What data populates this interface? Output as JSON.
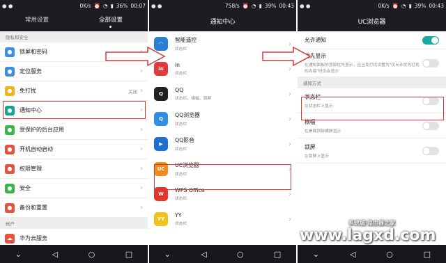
{
  "screen1": {
    "status": {
      "left": "",
      "net": "0K/s",
      "battery": "36%",
      "time": "00:07"
    },
    "tabs": [
      "常用设置",
      "全部设置"
    ],
    "active_tab": 1,
    "section1": "隐私和安全",
    "items": [
      {
        "label": "锁屏和密码",
        "icon": "lock-icon",
        "color": "#3d8fe0",
        "value": ""
      },
      {
        "label": "定位服务",
        "icon": "location-icon",
        "color": "#3d8fe0",
        "value": ""
      },
      {
        "label": "免打扰",
        "icon": "moon-icon",
        "color": "#f2b21c",
        "value": "关闭"
      },
      {
        "label": "通知中心",
        "icon": "notification-icon",
        "color": "#1aa39a",
        "value": ""
      },
      {
        "label": "受保护的后台应用",
        "icon": "shield-icon",
        "color": "#39b54a",
        "value": ""
      },
      {
        "label": "开机自动启动",
        "icon": "power-icon",
        "color": "#e2543e",
        "value": ""
      },
      {
        "label": "权限管理",
        "icon": "key-icon",
        "color": "#e2543e",
        "value": ""
      },
      {
        "label": "安全",
        "icon": "security-icon",
        "color": "#39b54a",
        "value": ""
      },
      {
        "label": "备份和重置",
        "icon": "backup-icon",
        "color": "#e2543e",
        "value": ""
      }
    ],
    "section2": "帐户",
    "account_item": {
      "label": "华为云服务",
      "icon": "cloud-icon",
      "color": "#e2543e"
    }
  },
  "screen2": {
    "status": {
      "net": "758/s",
      "battery": "39%",
      "time": "00:43"
    },
    "title": "通知中心",
    "apps": [
      {
        "name": "智能遥控",
        "sub": "状态栏",
        "icon": "remote-icon",
        "color": "#2a7fd4",
        "glyph": "◠"
      },
      {
        "name": "in",
        "sub": "状态栏",
        "icon": "in-icon",
        "color": "#e23a3a",
        "glyph": "in"
      },
      {
        "name": "QQ",
        "sub": "状态栏、横幅、锁屏",
        "icon": "qq-icon",
        "color": "#222222",
        "glyph": "Q"
      },
      {
        "name": "QQ浏览器",
        "sub": "状态栏",
        "icon": "qq-browser-icon",
        "color": "#2f8fe6",
        "glyph": "Q"
      },
      {
        "name": "QQ影音",
        "sub": "状态栏",
        "icon": "qq-player-icon",
        "color": "#1f6fd1",
        "glyph": "▶"
      },
      {
        "name": "UC浏览器",
        "sub": "状态栏",
        "icon": "uc-browser-icon",
        "color": "#f08a1c",
        "glyph": "UC"
      },
      {
        "name": "WPS Office",
        "sub": "状态栏",
        "icon": "wps-icon",
        "color": "#e8332a",
        "glyph": "W"
      },
      {
        "name": "YY",
        "sub": "状态栏",
        "icon": "yy-icon",
        "color": "#f2c21c",
        "glyph": "YY"
      }
    ]
  },
  "screen3": {
    "status": {
      "net": "0K/s",
      "battery": "39%",
      "time": "00:43"
    },
    "title": "UC浏览器",
    "allow": {
      "label": "允许通知",
      "on": true
    },
    "priority": {
      "label": "优先显示",
      "desc": "在通知面板的顶部优先显示，且当免打扰设置为\"仅允许优先打扰的内容\"时仍会显示",
      "on": false
    },
    "section": "通知方式",
    "methods": [
      {
        "label": "状态栏",
        "desc": "在状态栏上显示",
        "on": false
      },
      {
        "label": "横幅",
        "desc": "在桌面顶部横屏显示",
        "on": false
      },
      {
        "label": "锁屏",
        "desc": "在锁屏上显示",
        "on": false
      }
    ]
  },
  "watermark": {
    "main": "www.lagxd.com",
    "top": "系统城·路由器之家"
  },
  "colors": {
    "highlight": "#d43a3a",
    "accent": "#1ba8a0",
    "bar": "#1c1c22"
  }
}
